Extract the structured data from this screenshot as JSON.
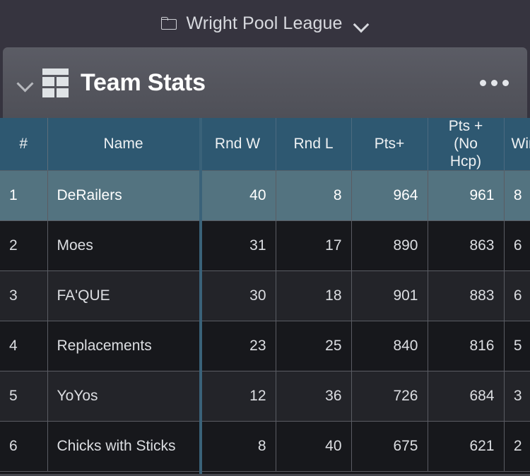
{
  "topbar": {
    "folder_icon": "folder-icon",
    "title": "Wright Pool League",
    "dropdown_icon": "chevron-down-icon"
  },
  "panel": {
    "collapse_icon": "chevron-down-icon",
    "grid_icon": "table-grid-icon",
    "title": "Team Stats",
    "more_icon": "ellipsis-icon"
  },
  "table": {
    "columns": [
      {
        "key": "idx",
        "label": "#"
      },
      {
        "key": "name",
        "label": "Name"
      },
      {
        "key": "rndw",
        "label": "Rnd W"
      },
      {
        "key": "rndl",
        "label": "Rnd L"
      },
      {
        "key": "pts",
        "label": "Pts+"
      },
      {
        "key": "ptsnh",
        "label": "Pts + (No Hcp)"
      },
      {
        "key": "wins",
        "label": "Win"
      }
    ],
    "rows": [
      {
        "idx": "1",
        "name": "DeRailers",
        "rndw": "40",
        "rndl": "8",
        "pts": "964",
        "ptsnh": "961",
        "wins": "8",
        "selected": true
      },
      {
        "idx": "2",
        "name": "Moes",
        "rndw": "31",
        "rndl": "17",
        "pts": "890",
        "ptsnh": "863",
        "wins": "6",
        "selected": false
      },
      {
        "idx": "3",
        "name": "FA'QUE",
        "rndw": "30",
        "rndl": "18",
        "pts": "901",
        "ptsnh": "883",
        "wins": "6",
        "selected": false
      },
      {
        "idx": "4",
        "name": "Replacements",
        "rndw": "23",
        "rndl": "25",
        "pts": "840",
        "ptsnh": "816",
        "wins": "5",
        "selected": false
      },
      {
        "idx": "5",
        "name": "YoYos",
        "rndw": "12",
        "rndl": "36",
        "pts": "726",
        "ptsnh": "684",
        "wins": "3",
        "selected": false
      },
      {
        "idx": "6",
        "name": "Chicks with Sticks",
        "rndw": "8",
        "rndl": "40",
        "pts": "675",
        "ptsnh": "621",
        "wins": "2",
        "selected": false
      }
    ]
  },
  "colors": {
    "topbar_bg": "#36343f",
    "panel_bg": "#55565e",
    "header_blue": "#2e5871",
    "row_selected": "#537380",
    "row_odd": "#232429",
    "row_even": "#17181c",
    "freeze_divider": "#3a6279",
    "grid_line": "#5a5c63"
  }
}
